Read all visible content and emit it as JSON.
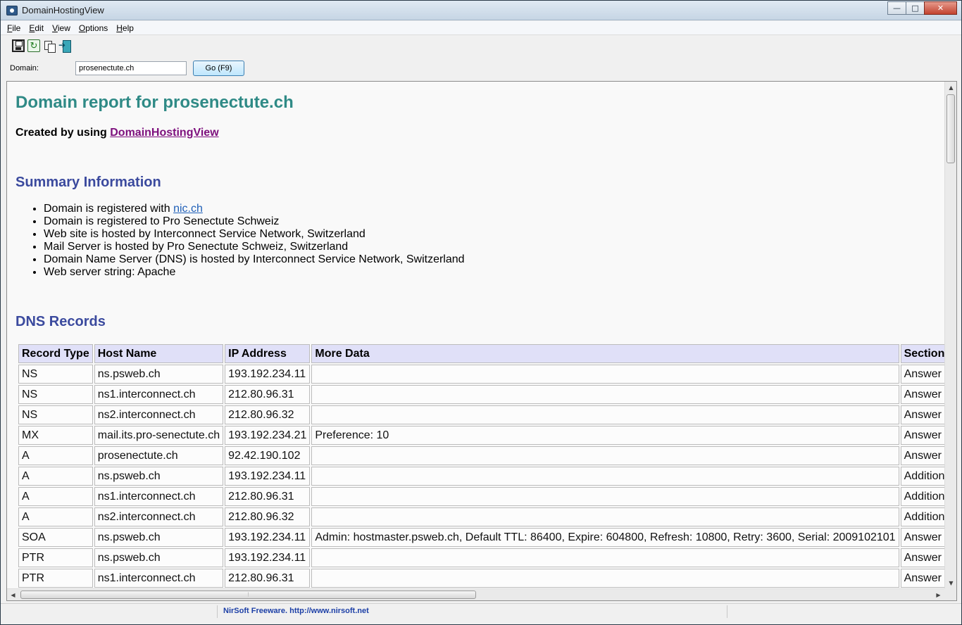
{
  "window": {
    "title": "DomainHostingView",
    "minimize": "—",
    "maximize": "□",
    "close": "✕"
  },
  "menu": {
    "items": [
      {
        "label": "File",
        "key": "F",
        "rest": "ile"
      },
      {
        "label": "Edit",
        "key": "E",
        "rest": "dit"
      },
      {
        "label": "View",
        "key": "V",
        "rest": "iew"
      },
      {
        "label": "Options",
        "key": "O",
        "rest": "ptions"
      },
      {
        "label": "Help",
        "key": "H",
        "rest": "elp"
      }
    ]
  },
  "toolbar": {
    "icons": [
      "save-icon",
      "refresh-icon",
      "copy-icon",
      "exit-icon"
    ]
  },
  "domain": {
    "label": "Domain:",
    "value": "prosenectute.ch",
    "go_label": "Go   (F9)"
  },
  "report": {
    "title": "Domain report for prosenectute.ch",
    "created_prefix": "Created by using ",
    "created_link": "DomainHostingView",
    "summary_title": "Summary Information",
    "summary": {
      "registered_with_prefix": "Domain is registered with ",
      "registered_with_link": "nic.ch",
      "registered_to": "Domain is registered to Pro Senectute Schweiz",
      "web_hosted": "Web site is hosted by Interconnect Service Network, Switzerland",
      "mail_hosted": "Mail Server is hosted by Pro Senectute Schweiz, Switzerland",
      "dns_hosted": "Domain Name Server (DNS) is hosted by Interconnect Service Network, Switzerland",
      "web_server": "Web server string: Apache"
    },
    "dns_title": "DNS Records",
    "dns_headers": [
      "Record Type",
      "Host Name",
      "IP Address",
      "More Data",
      "Section"
    ],
    "dns_rows": [
      [
        "NS",
        "ns.psweb.ch",
        "193.192.234.11",
        "",
        "Answer"
      ],
      [
        "NS",
        "ns1.interconnect.ch",
        "212.80.96.31",
        "",
        "Answer"
      ],
      [
        "NS",
        "ns2.interconnect.ch",
        "212.80.96.32",
        "",
        "Answer"
      ],
      [
        "MX",
        "mail.its.pro-senectute.ch",
        "193.192.234.21",
        "Preference: 10",
        "Answer"
      ],
      [
        "A",
        "prosenectute.ch",
        "92.42.190.102",
        "",
        "Answer"
      ],
      [
        "A",
        "ns.psweb.ch",
        "193.192.234.11",
        "",
        "Additional"
      ],
      [
        "A",
        "ns1.interconnect.ch",
        "212.80.96.31",
        "",
        "Additional"
      ],
      [
        "A",
        "ns2.interconnect.ch",
        "212.80.96.32",
        "",
        "Additional"
      ],
      [
        "SOA",
        "ns.psweb.ch",
        "193.192.234.11",
        "Admin: hostmaster.psweb.ch, Default TTL: 86400, Expire: 604800, Refresh: 10800, Retry: 3600, Serial: 2009102101",
        "Answer"
      ],
      [
        "PTR",
        "ns.psweb.ch",
        "193.192.234.11",
        "",
        "Answer"
      ],
      [
        "PTR",
        "ns1.interconnect.ch",
        "212.80.96.31",
        "",
        "Answer"
      ]
    ]
  },
  "statusbar": {
    "text": "NirSoft Freeware.  http://www.nirsoft.net"
  },
  "colors": {
    "title": "#2f8a86",
    "heading": "#3b4a9e",
    "header_bg": "#e0e0f8",
    "link_visited": "#7d0f7d",
    "link": "#1f5fb8",
    "status_text": "#1c3fa6"
  }
}
